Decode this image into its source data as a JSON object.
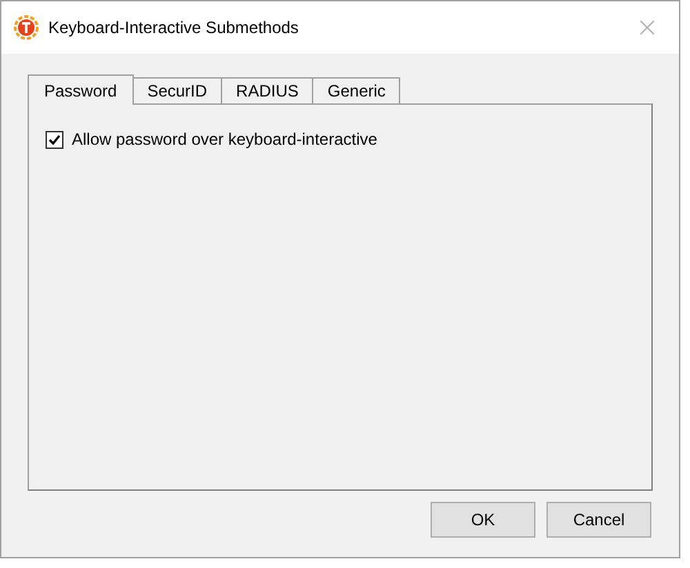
{
  "window": {
    "title": "Keyboard-Interactive Submethods"
  },
  "tabs": [
    {
      "label": "Password",
      "selected": true
    },
    {
      "label": "SecurID",
      "selected": false
    },
    {
      "label": "RADIUS",
      "selected": false
    },
    {
      "label": "Generic",
      "selected": false
    }
  ],
  "options": [
    {
      "label": "Allow password over keyboard-interactive",
      "checked": true
    }
  ],
  "buttons": [
    "OK",
    "Cancel"
  ]
}
